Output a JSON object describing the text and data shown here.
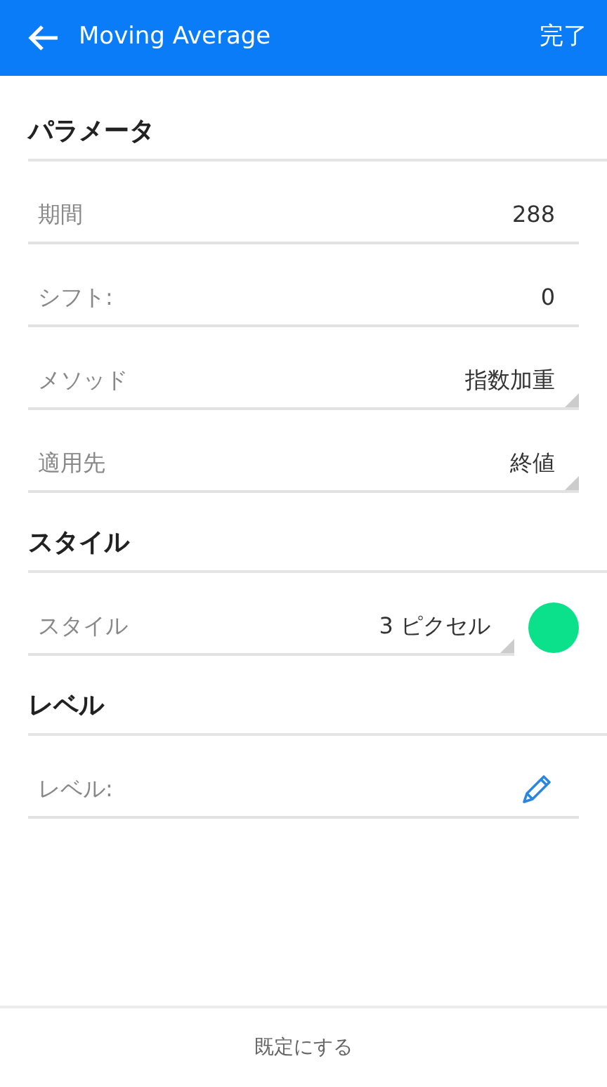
{
  "header": {
    "title": "Moving Average",
    "done": "完了"
  },
  "sections": [
    {
      "title": "パラメータ",
      "fields": [
        {
          "kind": "input",
          "label": "期間",
          "value": "288"
        },
        {
          "kind": "input",
          "label": "シフト:",
          "value": "0"
        },
        {
          "kind": "select",
          "label": "メソッド",
          "value": "指数加重"
        },
        {
          "kind": "select",
          "label": "適用先",
          "value": "終値"
        }
      ]
    },
    {
      "title": "スタイル",
      "fields": [
        {
          "kind": "style",
          "label": "スタイル",
          "value": "3 ピクセル",
          "color": "#0be08a"
        }
      ]
    },
    {
      "title": "レベル",
      "fields": [
        {
          "kind": "edit",
          "label": "レベル:"
        }
      ]
    }
  ],
  "footer": {
    "button": "既定にする"
  }
}
